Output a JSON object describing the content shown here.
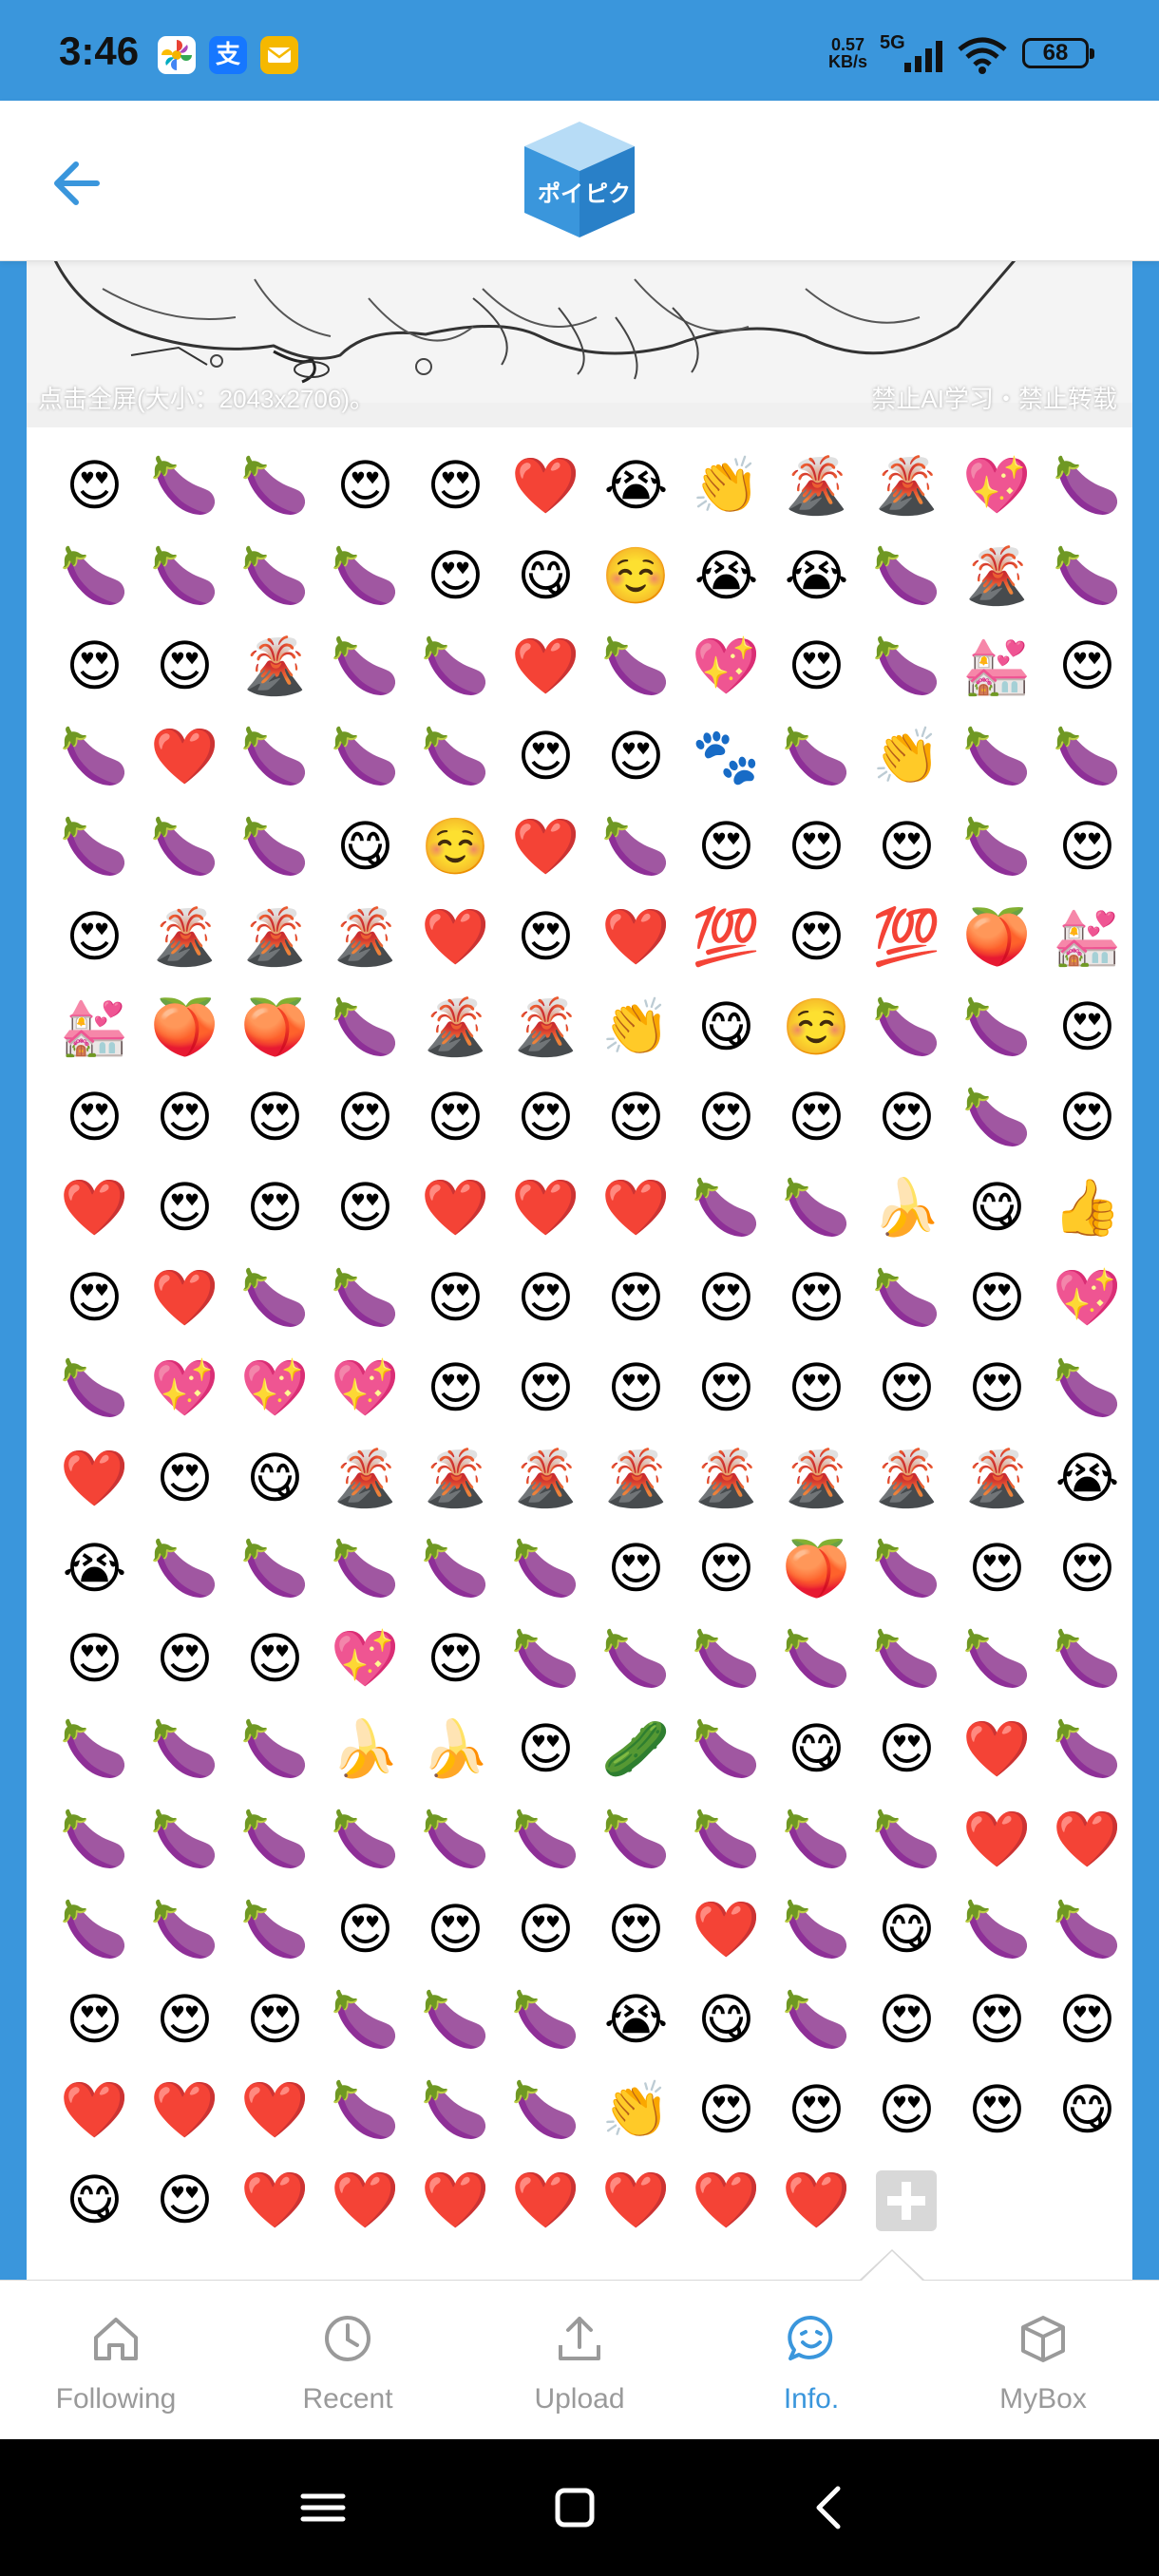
{
  "status_bar": {
    "time": "3:46",
    "net_speed_top": "0.57",
    "net_speed_bottom": "KB/s",
    "network_type": "5G",
    "battery": "68"
  },
  "header": {
    "back_icon": "back-arrow-icon",
    "logo_text": "ポイピク"
  },
  "illustration": {
    "fullscreen_info": "点击全屏(大小：2043x2706)。",
    "restriction_note": "禁止AI学习・禁止转载"
  },
  "emoji_rows": [
    "😍🍆🍆😍😍❤️😭👏🌋🌋💖🍆",
    "🍆🍆🍆🍆😍😋☺️😭😭🍆🌋🍆",
    "😍😍🌋🍆🍆❤️🍆💖😍🍆💒😍",
    "🍆❤️🍆🍆🍆😍😍🐾🍆👏🍆🍆",
    "🍆🍆🍆😋☺️❤️🍆😍😍😍🍆😍",
    "😍🌋🌋🌋❤️😍❤️💯😍💯🍑💒",
    "💒🍑🍑🍆🌋🌋👏😋☺️🍆🍆😍",
    "😍😍😍😍😍😍😍😍😍😍🍆😍",
    "❤️😍😍😍❤️❤️❤️🍆🍆🍌😋👍",
    "😍❤️🍆🍆😍😍😍😍😍🍆😍💖",
    "🍆💖💖💖😍😍😍😍😍😍😍🍆",
    "❤️😍😋🌋🌋🌋🌋🌋🌋🌋🌋😭",
    "😭🍆🍆🍆🍆🍆😍😍🍑🍆😍😍",
    "😍😍😍💖😍🍆🍆🍆🍆🍆🍆🍆",
    "🍆🍆🍆🍌🍌😍🥒🍆😋😍❤️🍆",
    "🍆🍆🍆🍆🍆🍆🍆🍆🍆🍆❤️❤️",
    "🍆🍆🍆😍😍😍😍❤️🍆😋🍆🍆",
    "😍😍😍🍆🍆🍆😭😋🍆😍😍😍",
    "❤️❤️❤️🍆🍆🍆👏😍😍😍😍😋",
    "😋😍❤️❤️❤️❤️❤️❤️❤️"
  ],
  "add_button_icon": "plus-icon",
  "nav": {
    "items": [
      {
        "label": "Following",
        "icon": "home-icon"
      },
      {
        "label": "Recent",
        "icon": "clock-icon"
      },
      {
        "label": "Upload",
        "icon": "upload-icon"
      },
      {
        "label": "Info.",
        "icon": "chat-icon"
      },
      {
        "label": "MyBox",
        "icon": "box-icon"
      }
    ],
    "active": "Info.",
    "active_color": "#3a96dc",
    "inactive_color": "#9a9a9a"
  },
  "system_nav": {
    "icons": [
      "menu-icon",
      "home-square-icon",
      "back-icon"
    ]
  },
  "colors": {
    "brand_blue": "#3a96dc",
    "header_bg": "#ffffff",
    "system_bar": "#000000"
  }
}
